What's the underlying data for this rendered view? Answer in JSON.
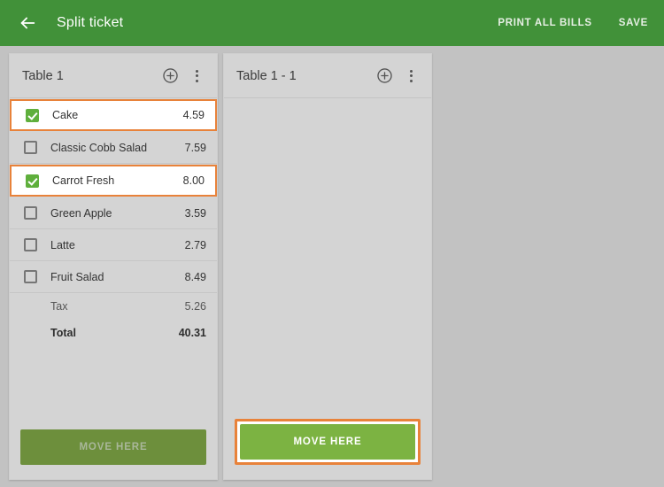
{
  "appbar": {
    "back_icon": "arrow-left-icon",
    "title": "Split ticket",
    "print_all_bills_label": "PRINT ALL BILLS",
    "save_label": "SAVE",
    "background_color": "#419139",
    "text_color": "#ffffff"
  },
  "colors": {
    "page_background": "#c2c2c2",
    "panel_background": "#d4d4d4",
    "highlight_orange": "#e8823a",
    "checkbox_green": "#5faf3c",
    "move_active_green": "#7cb342",
    "move_disabled_green": "#6d8f3c"
  },
  "panels": [
    {
      "title": "Table 1",
      "add_icon": "plus-circle-icon",
      "menu_icon": "more-vertical-icon",
      "items": [
        {
          "name": "Cake",
          "price": "4.59",
          "checked": true,
          "highlighted": true
        },
        {
          "name": "Classic Cobb Salad",
          "price": "7.59",
          "checked": false,
          "highlighted": false
        },
        {
          "name": "Carrot Fresh",
          "price": "8.00",
          "checked": true,
          "highlighted": true
        },
        {
          "name": "Green Apple",
          "price": "3.59",
          "checked": false,
          "highlighted": false
        },
        {
          "name": "Latte",
          "price": "2.79",
          "checked": false,
          "highlighted": false
        },
        {
          "name": "Fruit Salad",
          "price": "8.49",
          "checked": false,
          "highlighted": false
        }
      ],
      "summary": [
        {
          "label": "Tax",
          "value": "5.26",
          "bold": false
        },
        {
          "label": "Total",
          "value": "40.31",
          "bold": true
        }
      ],
      "move_button": {
        "label": "MOVE HERE",
        "state": "disabled",
        "highlighted": false
      }
    },
    {
      "title": "Table 1 - 1",
      "add_icon": "plus-circle-icon",
      "menu_icon": "more-vertical-icon",
      "items": [],
      "summary": [],
      "move_button": {
        "label": "MOVE HERE",
        "state": "active",
        "highlighted": true
      }
    }
  ]
}
